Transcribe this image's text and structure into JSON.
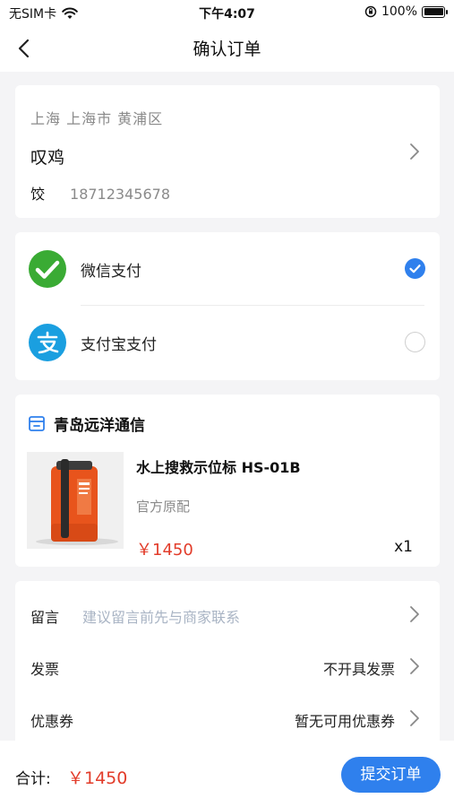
{
  "status_bar": {
    "carrier": "无SIM卡",
    "time": "下午4:07",
    "battery": "100%"
  },
  "nav": {
    "title": "确认订单"
  },
  "address": {
    "region": "上海 上海市 黄浦区",
    "name": "叹鸡",
    "phone_prefix": "饺",
    "phone": "18712345678"
  },
  "payment": {
    "options": [
      {
        "label": "微信支付",
        "selected": true
      },
      {
        "label": "支付宝支付",
        "selected": false
      }
    ],
    "colors": {
      "wechat": "#3aab34",
      "alipay": "#1a9fe0",
      "selected": "#2f80ed"
    }
  },
  "shop": {
    "name": "青岛远洋通信",
    "product_name": "水上搜救示位标 HS-01B",
    "spec": "官方原配",
    "price": "￥1450",
    "quantity": "x1"
  },
  "options": {
    "message": {
      "label": "留言",
      "placeholder": "建议留言前先与商家联系"
    },
    "invoice": {
      "label": "发票",
      "value": "不开具发票"
    },
    "coupon": {
      "label": "优惠券",
      "value": "暂无可用优惠券"
    }
  },
  "footer": {
    "total_label": "合计:",
    "total_value": "￥1450",
    "submit_label": "提交订单"
  },
  "accent_color": "#2f80ed",
  "price_color": "#e23c2a"
}
